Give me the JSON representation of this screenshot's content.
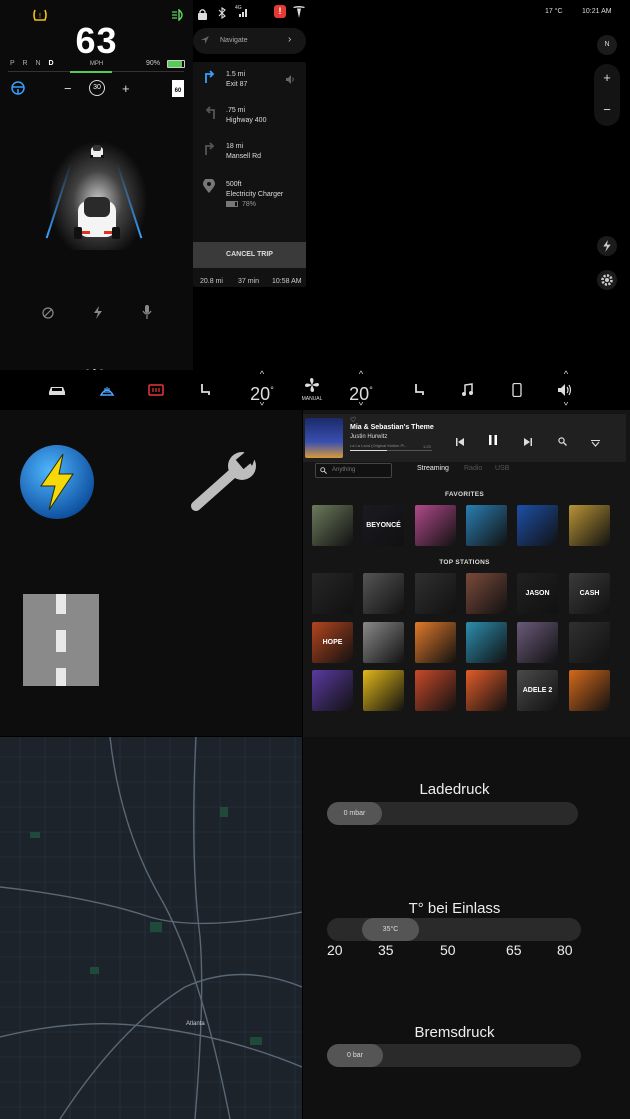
{
  "driving": {
    "speed": "63",
    "speed_unit": "MPH",
    "gears": [
      "P",
      "R",
      "N",
      "D"
    ],
    "active_gear": "D",
    "battery_percent": "90%",
    "battery_level": 0.9,
    "set_speed": "30",
    "speed_limit": "60",
    "minus_label": "−",
    "plus_label": "+",
    "page_dots": [
      false,
      true,
      false
    ],
    "icons": [
      "tpms-warning-icon",
      "headlight-icon",
      "steering-wheel-icon",
      "autopilot-off-icon",
      "lightning-icon",
      "microphone-icon"
    ]
  },
  "status_bar": {
    "temperature": "17 °C",
    "time": "10:21 AM",
    "signal_label": "4G",
    "icons": [
      "lock-icon",
      "bluetooth-icon",
      "signal-icon",
      "alert-icon",
      "tesla-logo-icon"
    ]
  },
  "navigation": {
    "search_placeholder": "Navigate",
    "steps": [
      {
        "distance": "1.5 mi",
        "road": "Exit 87",
        "icon": "turn-right-icon"
      },
      {
        "distance": ".75 mi",
        "road": "Highway 400",
        "icon": "turn-left-icon"
      },
      {
        "distance": "18 mi",
        "road": "Mansell Rd",
        "icon": "turn-right-icon"
      },
      {
        "distance": "500ft",
        "road": "Electricity Charger",
        "extra": "78%",
        "icon": "pin-icon"
      }
    ],
    "cancel_label": "CANCEL TRIP",
    "trip_distance": "20.8 mi",
    "trip_duration": "37 min",
    "arrival_time": "10:58 AM",
    "map_controls": {
      "compass": "N",
      "zoom_in": "+",
      "zoom_out": "−"
    }
  },
  "climate": {
    "driver_temp": "20",
    "passenger_temp": "20",
    "degree_symbol": "°",
    "fan_label": "MANUAL",
    "accent_color": "#4aa8ff",
    "defrost_color": "#e53935"
  },
  "media": {
    "track_title": "Mia & Sebastian's Theme",
    "artist": "Justin Hurwitz",
    "album_line": "La La Land (Original Motion Pi...",
    "time": "1:23",
    "tabs": [
      "Streaming",
      "Radio",
      "USB"
    ],
    "active_tab": "Streaming",
    "search_placeholder": "Anything",
    "favorites_title": "FAVORITES",
    "favorites_extra_text": [
      "BEYONCÉ"
    ],
    "top_stations_title": "TOP STATIONS",
    "stations_text": [
      "JASON DERULO",
      "CASH",
      "HOPE",
      "ADELE 2"
    ],
    "favorite_colors": [
      "#6b7a5c",
      "#1a1a22",
      "#b04a8a",
      "#2a7fb3",
      "#1d4fa8",
      "#b89436"
    ],
    "station_colors": [
      [
        "#262626",
        "#555555",
        "#303030",
        "#7a4a3a",
        "#202020",
        "#3a3a3a"
      ],
      [
        "#b3451f",
        "#8a8a8a",
        "#e07a2a",
        "#2c8fb0",
        "#6a5a7a",
        "#303030"
      ],
      [
        "#5a3aa0",
        "#e2b81a",
        "#c74a2a",
        "#e25c2a",
        "#4a4a4a",
        "#d46a1c"
      ]
    ]
  },
  "left_tiles": {
    "icons": [
      "charging-icon",
      "wrench-icon",
      "road-icon"
    ]
  },
  "map": {
    "city_label": "Atlanta"
  },
  "gauges": [
    {
      "title": "Ladedruck",
      "value_label": "0 mbar",
      "fraction": 0.0
    },
    {
      "title": "T° bei Einlass",
      "value_label": "35°C",
      "fraction": 0.25,
      "ticks": [
        "20",
        "35",
        "50",
        "65",
        "80"
      ]
    },
    {
      "title": "Bremsdruck",
      "value_label": "0 bar",
      "fraction": 0.0
    }
  ]
}
